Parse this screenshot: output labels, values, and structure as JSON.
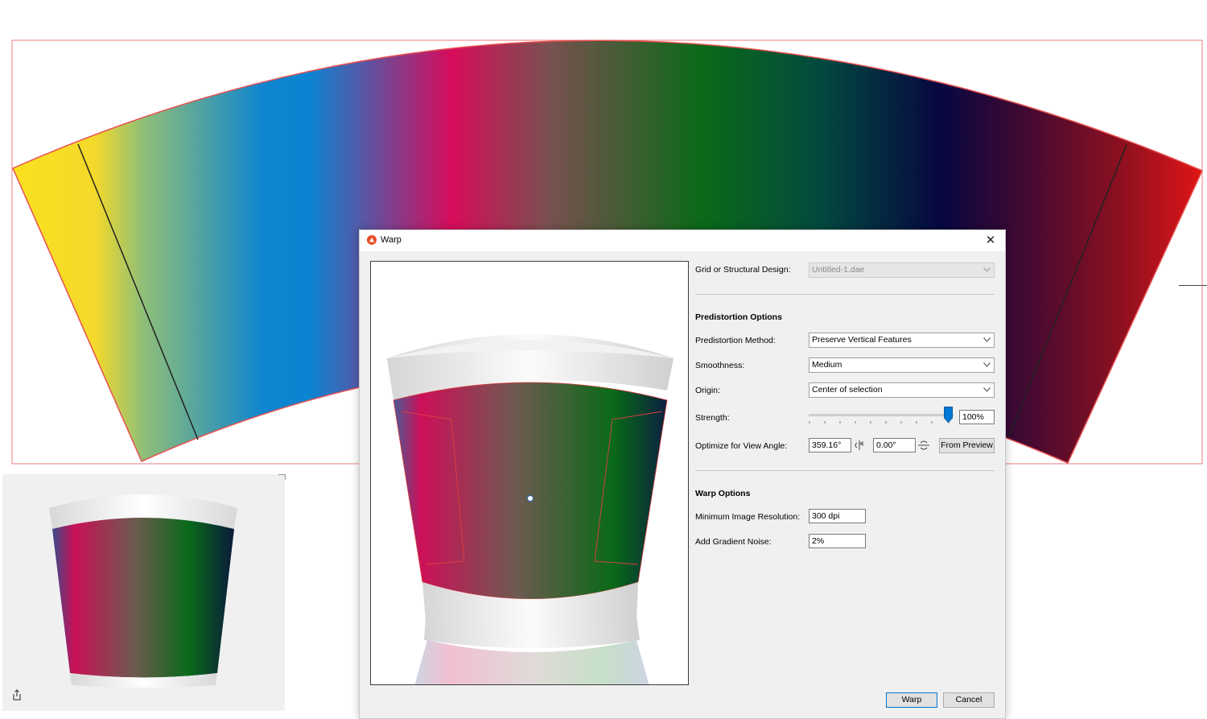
{
  "dialog": {
    "title": "Warp",
    "close_glyph": "✕",
    "grid_label": "Grid or Structural Design:",
    "grid_value": "Untitled-1.dae",
    "predistortion_header": "Predistortion Options",
    "method_label": "Predistortion Method:",
    "method_value": "Preserve Vertical Features",
    "smoothness_label": "Smoothness:",
    "smoothness_value": "Medium",
    "origin_label": "Origin:",
    "origin_value": "Center of selection",
    "strength_label": "Strength:",
    "strength_value": "100%",
    "strength_fraction": 1.0,
    "view_angle_label": "Optimize for View Angle:",
    "view_angle_h": "359.16°",
    "view_angle_v": "0.00°",
    "from_preview_label": "From Preview",
    "warp_header": "Warp Options",
    "min_res_label": "Minimum Image Resolution:",
    "min_res_value": "300 dpi",
    "noise_label": "Add Gradient Noise:",
    "noise_value": "2%",
    "warp_button": "Warp",
    "cancel_button": "Cancel"
  },
  "icons": {
    "app": "app-logo-icon",
    "close": "close-icon",
    "chevron": "chevron-down-icon",
    "rotate_h": "rotate-horizontal-icon",
    "rotate_v": "rotate-vertical-icon",
    "share": "share-icon"
  },
  "colors": {
    "accent": "#0078d7",
    "selection_outline": "#e05050",
    "gradient": [
      "#f8da2a",
      "#0a84d0",
      "#d0105a",
      "#0b6a1c",
      "#0a0a50",
      "#c81616"
    ]
  }
}
